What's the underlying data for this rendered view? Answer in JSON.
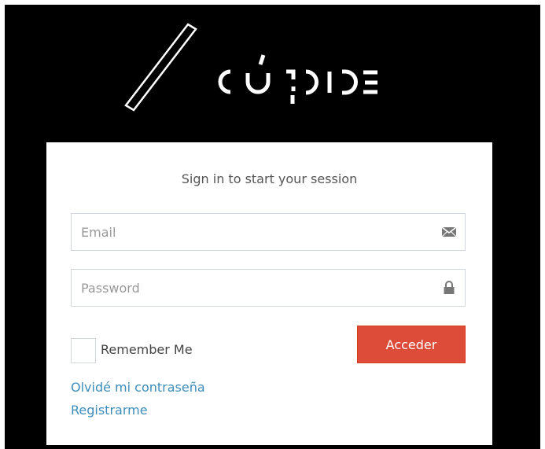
{
  "brand": {
    "logo_text": "CÚSPIDE"
  },
  "login_box": {
    "title": "Sign in to start your session",
    "email": {
      "placeholder": "Email",
      "value": "",
      "icon": "envelope-icon"
    },
    "password": {
      "placeholder": "Password",
      "value": "",
      "icon": "lock-icon"
    },
    "remember_label": "Remember Me",
    "remember_checked": false,
    "submit_label": "Acceder",
    "forgot_password_label": "Olvidé mi contraseña",
    "register_label": "Registrarme"
  },
  "colors": {
    "background": "#000000",
    "card": "#ffffff",
    "primary_button": "#dd4b39",
    "link": "#3c8dbc",
    "border": "#d2d6de",
    "icon": "#777777"
  }
}
